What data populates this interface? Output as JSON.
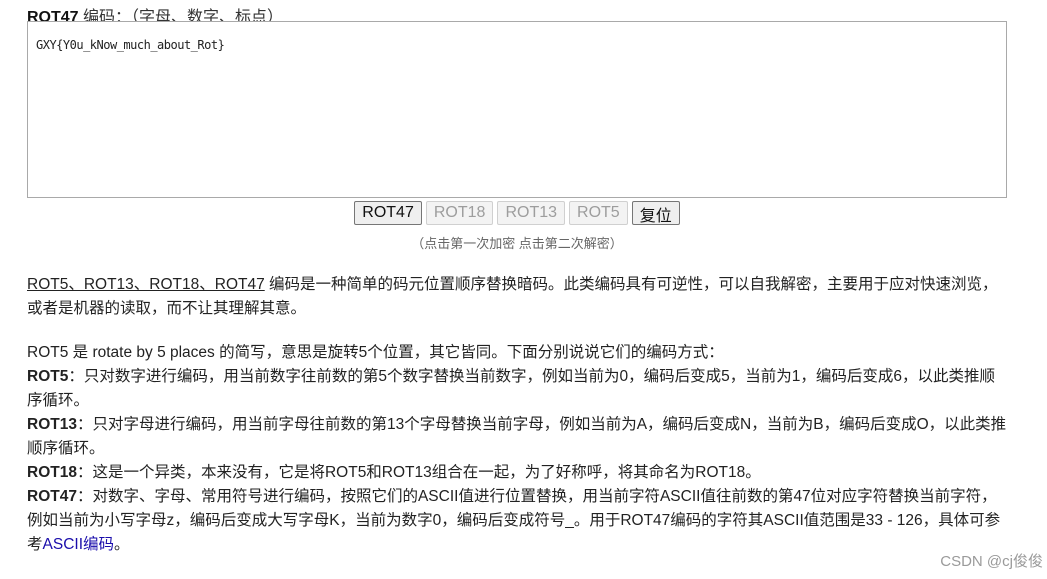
{
  "header": {
    "title": "ROT47",
    "label": "编码：（字母、数字、标点）"
  },
  "editor": {
    "value": "GXY{Y0u_kNow_much_about_Rot}"
  },
  "buttons": {
    "rot47": "ROT47",
    "rot18": "ROT18",
    "rot13": "ROT13",
    "rot5": "ROT5",
    "reset": "复位"
  },
  "hint": "（点击第一次加密 点击第二次解密）",
  "description": {
    "intro_link": "ROT5、ROT13、ROT18、ROT47",
    "intro_text": " 编码是一种简单的码元位置顺序替换暗码。此类编码具有可逆性，可以自我解密，主要用于应对快速浏览，或者是机器的读取，而不让其理解其意。",
    "overview": "ROT5 是 rotate by 5 places 的简写，意思是旋转5个位置，其它皆同。下面分别说说它们的编码方式：",
    "items": [
      {
        "term": "ROT5",
        "text": "：只对数字进行编码，用当前数字往前数的第5个数字替换当前数字，例如当前为0，编码后变成5，当前为1，编码后变成6，以此类推顺序循环。"
      },
      {
        "term": "ROT13",
        "text": "：只对字母进行编码，用当前字母往前数的第13个字母替换当前字母，例如当前为A，编码后变成N，当前为B，编码后变成O，以此类推顺序循环。"
      },
      {
        "term": "ROT18",
        "text": "：这是一个异类，本来没有，它是将ROT5和ROT13组合在一起，为了好称呼，将其命名为ROT18。"
      },
      {
        "term": "ROT47",
        "text": "：对数字、字母、常用符号进行编码，按照它们的ASCII值进行位置替换，用当前字符ASCII值往前数的第47位对应字符替换当前字符，例如当前为小写字母z，编码后变成大写字母K，当前为数字0，编码后变成符号_。用于ROT47编码的字符其ASCII值范围是33 - 126，具体可参考"
      }
    ],
    "ascii_link": "ASCII编码",
    "end": "。"
  },
  "watermark": "CSDN @cj俊俊"
}
